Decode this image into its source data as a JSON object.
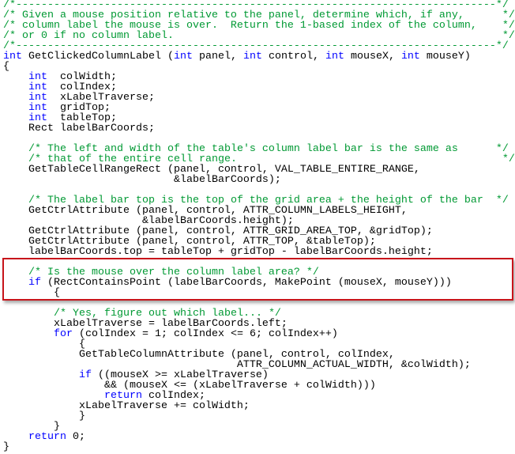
{
  "colors": {
    "keyword": "#0000ff",
    "comment": "#009933",
    "text": "#000000",
    "highlight_border": "#c8151b"
  },
  "highlight": {
    "from_line": 26,
    "to_line": 28
  },
  "lines": [
    [
      [
        "cm",
        "/*----------------------------------------------------------------------------*/"
      ]
    ],
    [
      [
        "cm",
        "/* Given a mouse position relative to the panel, determine which, if any,      */"
      ]
    ],
    [
      [
        "cm",
        "/* column label the mouse is over.  Return the 1-based index of the column,    */"
      ]
    ],
    [
      [
        "cm",
        "/* or 0 if no column label.                                                    */"
      ]
    ],
    [
      [
        "cm",
        "/*----------------------------------------------------------------------------*/"
      ]
    ],
    [
      [
        "kw",
        "int"
      ],
      [
        "tx",
        " GetClickedColumnLabel ("
      ],
      [
        "kw",
        "int"
      ],
      [
        "tx",
        " panel, "
      ],
      [
        "kw",
        "int"
      ],
      [
        "tx",
        " control, "
      ],
      [
        "kw",
        "int"
      ],
      [
        "tx",
        " mouseX, "
      ],
      [
        "kw",
        "int"
      ],
      [
        "tx",
        " mouseY)"
      ]
    ],
    [
      [
        "tx",
        "{"
      ]
    ],
    [
      [
        "tx",
        "    "
      ],
      [
        "kw",
        "int"
      ],
      [
        "tx",
        "  colWidth;"
      ]
    ],
    [
      [
        "tx",
        "    "
      ],
      [
        "kw",
        "int"
      ],
      [
        "tx",
        "  colIndex;"
      ]
    ],
    [
      [
        "tx",
        "    "
      ],
      [
        "kw",
        "int"
      ],
      [
        "tx",
        "  xLabelTraverse;"
      ]
    ],
    [
      [
        "tx",
        "    "
      ],
      [
        "kw",
        "int"
      ],
      [
        "tx",
        "  gridTop;"
      ]
    ],
    [
      [
        "tx",
        "    "
      ],
      [
        "kw",
        "int"
      ],
      [
        "tx",
        "  tableTop;"
      ]
    ],
    [
      [
        "tx",
        "    Rect labelBarCoords;"
      ]
    ],
    [],
    [
      [
        "tx",
        "    "
      ],
      [
        "cm",
        "/* The left and width of the table's column label bar is the same as      */"
      ]
    ],
    [
      [
        "tx",
        "    "
      ],
      [
        "cm",
        "/* that of the entire cell range.                                          */"
      ]
    ],
    [
      [
        "tx",
        "    GetTableCellRangeRect (panel, control, VAL_TABLE_ENTIRE_RANGE,"
      ]
    ],
    [
      [
        "tx",
        "                           &labelBarCoords);"
      ]
    ],
    [],
    [
      [
        "tx",
        "    "
      ],
      [
        "cm",
        "/* The label bar top is the top of the grid area + the height of the bar  */"
      ]
    ],
    [
      [
        "tx",
        "    GetCtrlAttribute (panel, control, ATTR_COLUMN_LABELS_HEIGHT,"
      ]
    ],
    [
      [
        "tx",
        "                      &labelBarCoords.height);"
      ]
    ],
    [
      [
        "tx",
        "    GetCtrlAttribute (panel, control, ATTR_GRID_AREA_TOP, &gridTop);"
      ]
    ],
    [
      [
        "tx",
        "    GetCtrlAttribute (panel, control, ATTR_TOP, &tableTop);"
      ]
    ],
    [
      [
        "tx",
        "    labelBarCoords.top = tableTop + gridTop - labelBarCoords.height;"
      ]
    ],
    [],
    [
      [
        "tx",
        "    "
      ],
      [
        "cm",
        "/* Is the mouse over the column label area? */"
      ]
    ],
    [
      [
        "tx",
        "    "
      ],
      [
        "kw",
        "if"
      ],
      [
        "tx",
        " (RectContainsPoint (labelBarCoords, MakePoint (mouseX, mouseY)))"
      ]
    ],
    [
      [
        "tx",
        "        {"
      ]
    ],
    [],
    [
      [
        "tx",
        "        "
      ],
      [
        "cm",
        "/* Yes, figure out which label... */"
      ]
    ],
    [
      [
        "tx",
        "        xLabelTraverse = labelBarCoords.left;"
      ]
    ],
    [
      [
        "tx",
        "        "
      ],
      [
        "kw",
        "for"
      ],
      [
        "tx",
        " (colIndex = 1; colIndex <= 6; colIndex++)"
      ]
    ],
    [
      [
        "tx",
        "            {"
      ]
    ],
    [
      [
        "tx",
        "            GetTableColumnAttribute (panel, control, colIndex,"
      ]
    ],
    [
      [
        "tx",
        "                                     ATTR_COLUMN_ACTUAL_WIDTH, &colWidth);"
      ]
    ],
    [
      [
        "tx",
        "            "
      ],
      [
        "kw",
        "if"
      ],
      [
        "tx",
        " ((mouseX >= xLabelTraverse)"
      ]
    ],
    [
      [
        "tx",
        "                && (mouseX <= (xLabelTraverse + colWidth)))"
      ]
    ],
    [
      [
        "tx",
        "                "
      ],
      [
        "kw",
        "return"
      ],
      [
        "tx",
        " colIndex;"
      ]
    ],
    [
      [
        "tx",
        "            xLabelTraverse += colWidth;"
      ]
    ],
    [
      [
        "tx",
        "            }"
      ]
    ],
    [
      [
        "tx",
        "        }"
      ]
    ],
    [
      [
        "tx",
        "    "
      ],
      [
        "kw",
        "return"
      ],
      [
        "tx",
        " 0;"
      ]
    ],
    [
      [
        "tx",
        "}"
      ]
    ]
  ]
}
